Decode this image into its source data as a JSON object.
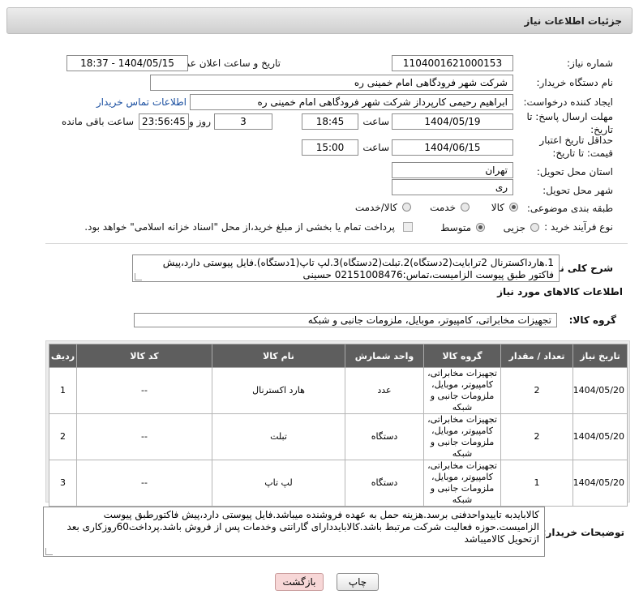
{
  "header": {
    "title": "جزئیات اطلاعات نیاز"
  },
  "form": {
    "need_number_label": "شماره نیاز:",
    "need_number": "1104001621000153",
    "announce_label": "تاریخ و ساعت اعلان عمومی:",
    "announce_value": "1404/05/15 - 18:37",
    "buyer_org_label": "نام دستگاه خریدار:",
    "buyer_org": "شرکت شهر فرودگاهی امام خمینی  ره",
    "creator_label": "ایجاد کننده درخواست:",
    "creator": "ابراهیم رحیمی کارپرداز شرکت شهر فرودگاهی امام خمینی  ره",
    "contact_link": "اطلاعات تماس خریدار",
    "deadline_label": "مهلت ارسال پاسخ: تا تاریخ:",
    "deadline_date": "1404/05/19",
    "time_label": "ساعت",
    "deadline_time": "18:45",
    "days_value": "3",
    "days_label": "روز و",
    "remaining_time": "23:56:45",
    "remaining_label": "ساعت باقی مانده",
    "validity_label": "حداقل تاریخ اعتبار قیمت: تا تاریخ:",
    "validity_date": "1404/06/15",
    "validity_time": "15:00",
    "province_label": "استان محل تحویل:",
    "province": "تهران",
    "city_label": "شهر محل تحویل:",
    "city": "ری",
    "category_label": "طبقه بندی موضوعی:",
    "category_options": [
      "کالا",
      "خدمت",
      "کالا/خدمت"
    ],
    "process_label": "نوع فرآیند خرید :",
    "process_options": [
      "جزیی",
      "متوسط"
    ],
    "payment_note": "پرداخت تمام یا بخشی از مبلغ خرید،از محل \"اسناد خزانه اسلامی\" خواهد بود.",
    "summary_label": "شرح کلی نیاز:",
    "summary": "1.هارداکسترنال 2ترابایت(2دستگاه)2.تبلت(2دستگاه)3.لپ تاپ(1دستگاه).فایل پیوستی دارد،پیش فاکتور طبق پیوست الزامیست،تماس:02151008476 حسینی"
  },
  "goods": {
    "section_title": "اطلاعات کالاهای مورد نیاز",
    "group_label": "گروه کالا:",
    "group_value": "تجهیزات مخابراتی، کامپیوتر، موبایل، ملزومات جانبی و شبکه",
    "columns": [
      "ردیف",
      "کد کالا",
      "نام کالا",
      "واحد شمارش",
      "گروه کالا",
      "تعداد / مقدار",
      "تاریخ نیاز"
    ],
    "rows": [
      {
        "row": "1",
        "code": "--",
        "name": "هارد اکسترنال",
        "unit": "عدد",
        "group": "تجهیزات مخابراتی، کامپیوتر، موبایل، ملزومات جانبی و شبکه",
        "qty": "2",
        "date": "1404/05/20"
      },
      {
        "row": "2",
        "code": "--",
        "name": "تبلت",
        "unit": "دستگاه",
        "group": "تجهیزات مخابراتی، کامپیوتر، موبایل، ملزومات جانبی و شبکه",
        "qty": "2",
        "date": "1404/05/20"
      },
      {
        "row": "3",
        "code": "--",
        "name": "لپ تاپ",
        "unit": "دستگاه",
        "group": "تجهیزات مخابراتی، کامپیوتر، موبایل، ملزومات جانبی و شبکه",
        "qty": "1",
        "date": "1404/05/20"
      }
    ]
  },
  "buyer_notes": {
    "label": "توضیحات خریدار:",
    "text": "کالابایدبه تاییدواحدفنی برسد.هزینه حمل به عهده فروشنده میباشد.فایل پیوستی دارد،پیش فاکتورطبق پیوست الزامیست.حوزه فعالیت شرکت مرتبط باشد.کالابایددارای گارانتی وخدمات پس از فروش باشد.پرداخت60روزکاری بعد ازتحویل کالامیباشد"
  },
  "buttons": {
    "print": "چاپ",
    "back": "بازگشت"
  }
}
